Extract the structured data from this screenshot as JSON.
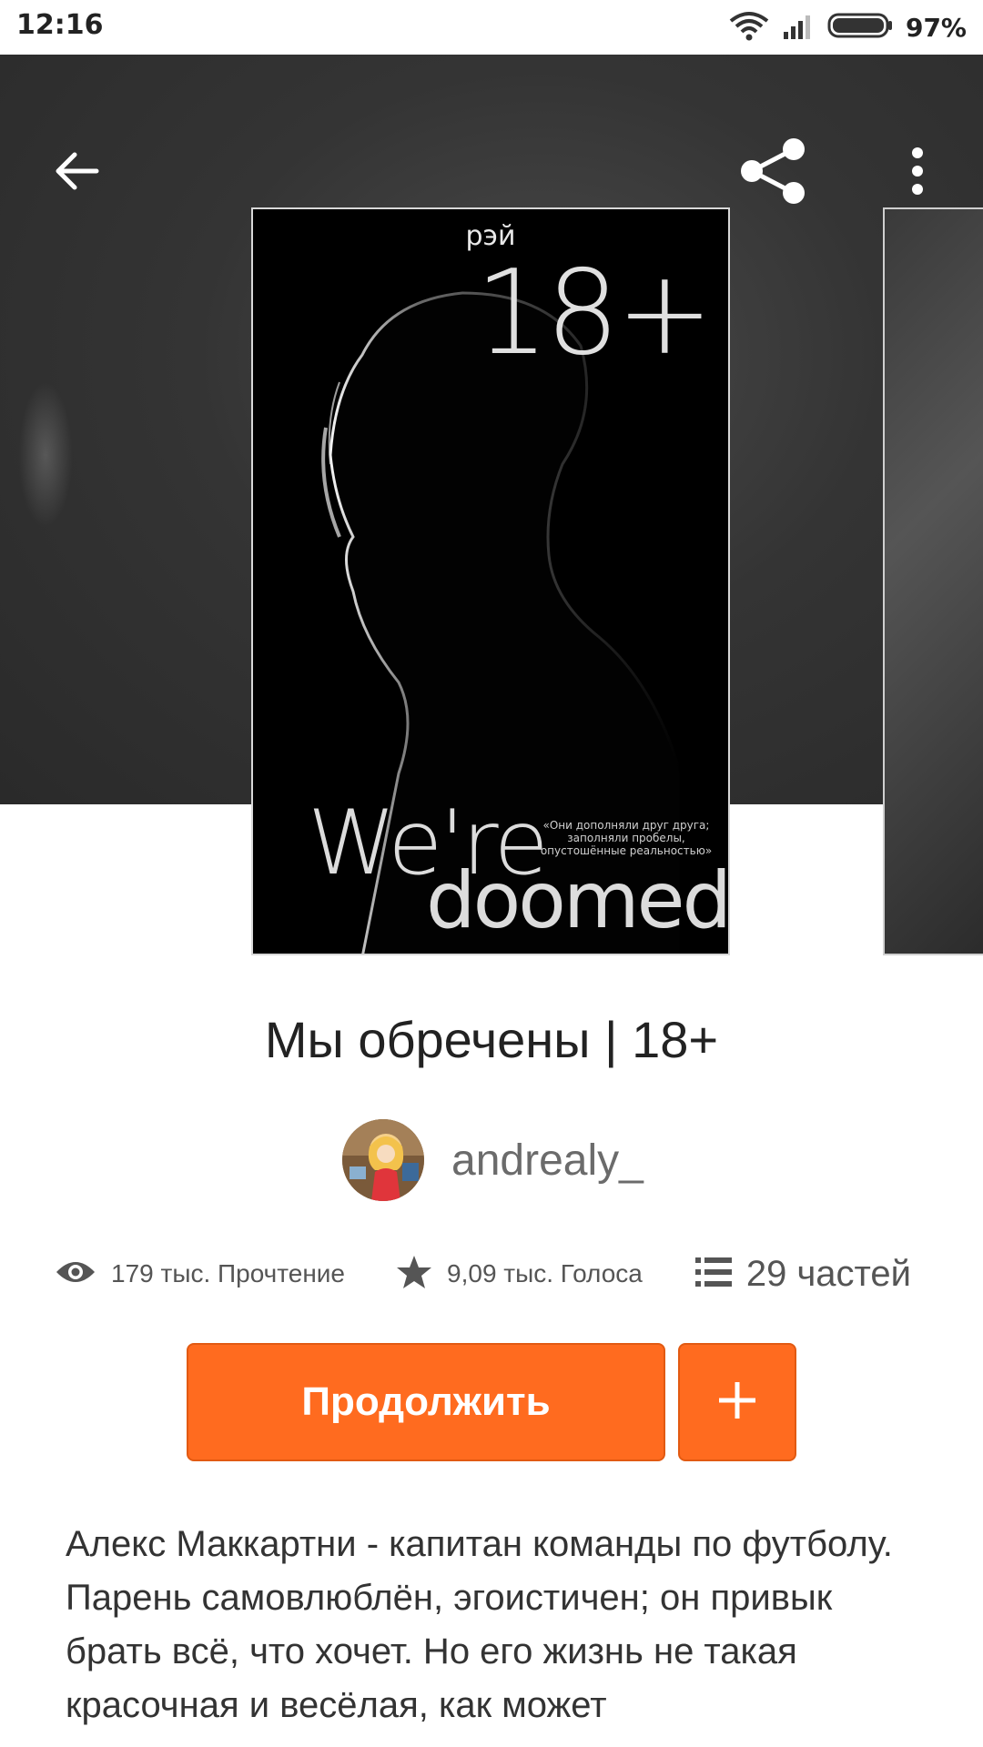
{
  "status_bar": {
    "time": "12:16",
    "battery": "97%",
    "icons": [
      "wifi-icon",
      "signal-icon",
      "battery-icon"
    ]
  },
  "toolbar": {
    "back_icon": "arrow-left-icon",
    "share_icon": "share-icon",
    "more_icon": "more-vertical-icon"
  },
  "cover": {
    "author_on_cover": "рэй",
    "rating_badge": "18+",
    "title_line1": "We're",
    "title_line2": "doomed",
    "quote": "«Они дополняли друг друга; заполняли пробелы, опустошённые реальностью»"
  },
  "book": {
    "title": "Мы обречены | 18+",
    "author": "andrealy_"
  },
  "stats": {
    "reads": "179 тыс. Прочтение",
    "votes": "9,09 тыс. Голоса",
    "parts": "29 частей"
  },
  "actions": {
    "continue_label": "Продолжить",
    "add_icon": "plus-icon"
  },
  "description": "Алекс Маккартни - капитан команды по футболу. Парень самовлюблён, эгоистичен; он привык брать всё, что хочет. Но его жизнь не такая красочная и весёлая, как может",
  "colors": {
    "accent": "#ff6b1f",
    "hero_bg": "#343434"
  }
}
